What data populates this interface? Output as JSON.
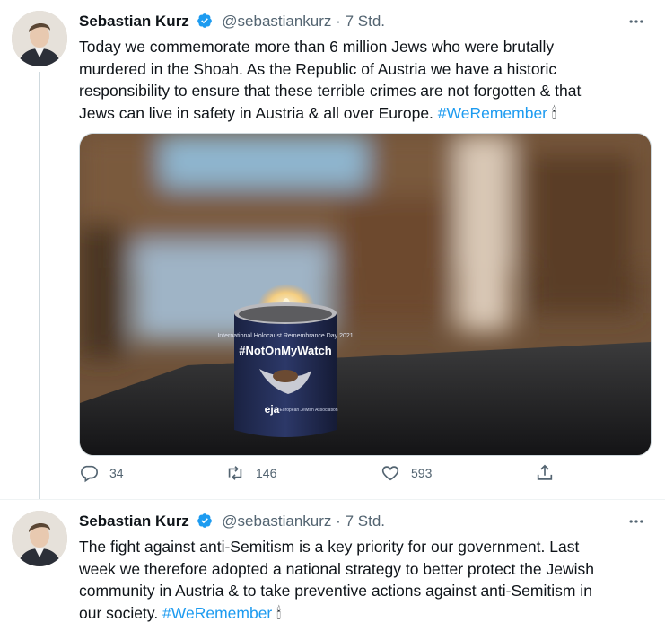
{
  "tweets": [
    {
      "author": {
        "name": "Sebastian Kurz",
        "handle": "@sebastiankurz",
        "separator": "·",
        "time": "7 Std."
      },
      "text_lines": [
        "Today we commemorate more than 6 million Jews who were brutally",
        "murdered in the Shoah. As the Republic of Austria we have a historic",
        "responsibility to ensure that these terrible crimes are not forgotten & that",
        "Jews can live in safety in Austria & all over Europe."
      ],
      "hashtag": "#WeRemember",
      "emoji": "🕯",
      "media": {
        "can_title": "#NotOnMyWatch",
        "can_header": "International Holocaust Remembrance Day 2021",
        "can_logo": "eja",
        "can_logo_sub": "European Jewish Association"
      },
      "stats": {
        "replies": "34",
        "retweets": "146",
        "likes": "593"
      }
    },
    {
      "author": {
        "name": "Sebastian Kurz",
        "handle": "@sebastiankurz",
        "separator": "·",
        "time": "7 Std."
      },
      "text_lines": [
        "The fight against anti-Semitism is a key priority for our government. Last",
        "week we therefore adopted a national strategy to better protect the Jewish",
        "community in Austria & to take preventive actions against anti-Semitism in",
        "our society. "
      ],
      "hashtag": "#WeRemember",
      "emoji": "🕯"
    }
  ],
  "colors": {
    "link": "#1d9bf0",
    "secondary_text": "#536471",
    "verified": "#1d9bf0"
  },
  "icons": [
    "verified-icon",
    "more-icon",
    "reply-icon",
    "retweet-icon",
    "like-icon",
    "share-icon"
  ]
}
